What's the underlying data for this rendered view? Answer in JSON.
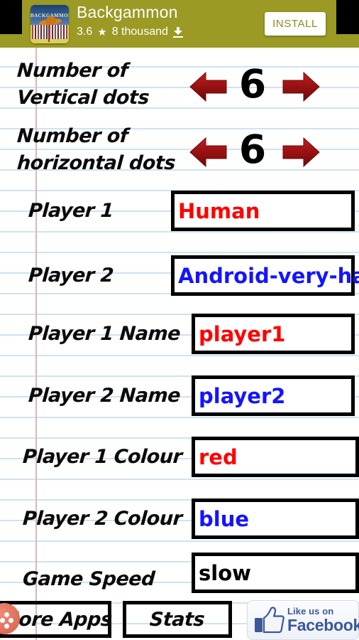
{
  "ad": {
    "app_name": "Backgammon",
    "rating": "3.6",
    "star_icon": "star-icon",
    "downloads": "8 thousand",
    "download_icon": "download-icon",
    "install_label": "INSTALL",
    "icon_title": "BACKGAMMON",
    "banner_color": "#9a9a24",
    "install_text_color": "#8a8a22"
  },
  "settings": {
    "steppers": [
      {
        "label_line1": "Number of",
        "label_line2": "Vertical dots",
        "value": "6",
        "left_icon": "arrow-left-icon",
        "right_icon": "arrow-right-icon"
      },
      {
        "label_line1": "Number of",
        "label_line2": "horizontal dots",
        "value": "6",
        "left_icon": "arrow-left-icon",
        "right_icon": "arrow-right-icon"
      }
    ],
    "fields": [
      {
        "label": "Player 1",
        "value": "Human",
        "color": "#ff0000"
      },
      {
        "label": "Player 2",
        "value": "Android-very-hard",
        "color": "#1414ff"
      },
      {
        "label": "Player 1 Name",
        "value": "player1",
        "color": "#ff0000"
      },
      {
        "label": "Player 2 Name",
        "value": "player2",
        "color": "#1414ff"
      },
      {
        "label": "Player 1 Colour",
        "value": "red",
        "color": "#ff0000"
      },
      {
        "label": "Player 2 Colour",
        "value": "blue",
        "color": "#1414ff"
      },
      {
        "label": "Game Speed",
        "value": "slow",
        "color": "#000000"
      }
    ]
  },
  "bottom": {
    "more_apps_label": "More Apps",
    "more_apps_icon": "more-apps-icon",
    "stats_label": "Stats",
    "facebook": {
      "like_text": "Like us on",
      "brand_text": "Facebook",
      "thumb_icon": "thumbs-up-icon",
      "brand_color": "#3b5998"
    }
  },
  "theme": {
    "arrow_color": "#9c1212",
    "rule_line_color": "#cfe2f1",
    "margin_line_color": "#d8b7bb"
  }
}
